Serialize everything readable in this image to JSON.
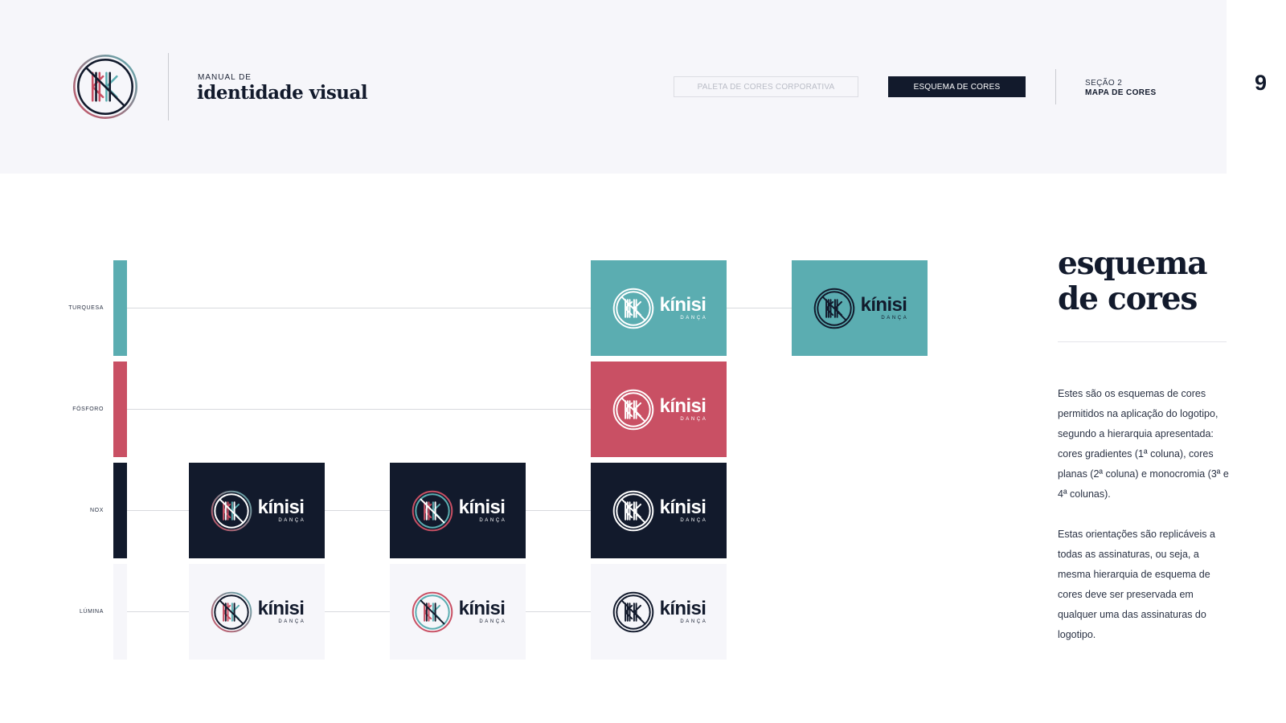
{
  "header": {
    "brand_small": "MANUAL DE",
    "brand_big": "identidade visual",
    "nav_inactive": "PALETA DE CORES CORPORATIVA",
    "nav_active": "ESQUEMA DE CORES",
    "section_label": "SEÇÃO 2",
    "section_name": "MAPA DE CORES",
    "page_number": "9"
  },
  "colors": {
    "turquesa": "#5badb1",
    "fosforo": "#c95064",
    "nox": "#121a2c",
    "lumina": "#f6f6fa"
  },
  "color_map": {
    "rows": [
      {
        "label": "TURQUESA",
        "color": "#5badb1"
      },
      {
        "label": "FÓSFORO",
        "color": "#c95064"
      },
      {
        "label": "NOX",
        "color": "#121a2c"
      },
      {
        "label": "LÚMINA",
        "color": "#f6f6fa"
      }
    ],
    "tiles": [
      {
        "row": "turquesa",
        "column": 3,
        "background": "turquesa",
        "logo": "white"
      },
      {
        "row": "turquesa",
        "column": 4,
        "background": "turquesa",
        "logo": "nox"
      },
      {
        "row": "fosforo",
        "column": 3,
        "background": "fosforo",
        "logo": "white"
      },
      {
        "row": "nox",
        "column": 1,
        "background": "nox",
        "logo": "gradient"
      },
      {
        "row": "nox",
        "column": 2,
        "background": "nox",
        "logo": "flat"
      },
      {
        "row": "nox",
        "column": 3,
        "background": "nox",
        "logo": "white"
      },
      {
        "row": "lumina",
        "column": 1,
        "background": "lumina",
        "logo": "gradient"
      },
      {
        "row": "lumina",
        "column": 2,
        "background": "lumina",
        "logo": "flat"
      },
      {
        "row": "lumina",
        "column": 3,
        "background": "lumina",
        "logo": "nox"
      }
    ]
  },
  "logo": {
    "wordmark": "kínisi",
    "subtitle": "DANÇA"
  },
  "content": {
    "title_line1": "esquema",
    "title_line2": "de cores",
    "paragraph1": "Estes são os esquemas de cores permitidos na aplicação do logotipo, segundo a hierarquia apresentada: cores gradientes (1ª coluna), cores planas (2ª coluna) e monocromia (3ª e 4ª colunas).",
    "paragraph2": "Estas orientações são replicáveis a todas as assinaturas, ou seja, a mesma hierarquia de esquema de cores deve ser preservada em qualquer uma das assinaturas do logotipo."
  }
}
